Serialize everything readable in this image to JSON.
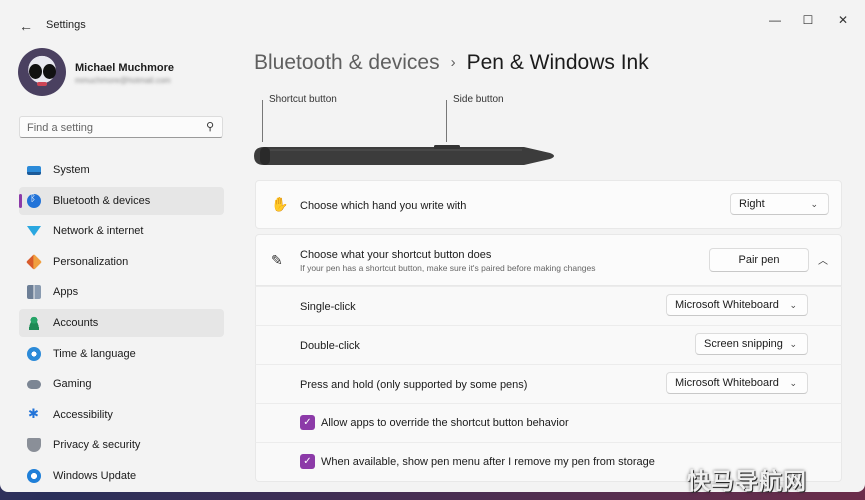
{
  "app": {
    "title": "Settings"
  },
  "window_controls": {
    "minimize": "—",
    "maximize": "☐",
    "close": "✕"
  },
  "user": {
    "name": "Michael Muchmore",
    "email": "mmuchmore@hotmail.com"
  },
  "search": {
    "placeholder": "Find a setting"
  },
  "sidebar": {
    "items": [
      {
        "label": "System",
        "icon": "system-icon"
      },
      {
        "label": "Bluetooth & devices",
        "icon": "bluetooth-icon",
        "active": true
      },
      {
        "label": "Network & internet",
        "icon": "network-icon"
      },
      {
        "label": "Personalization",
        "icon": "personalization-icon"
      },
      {
        "label": "Apps",
        "icon": "apps-icon"
      },
      {
        "label": "Accounts",
        "icon": "accounts-icon"
      },
      {
        "label": "Time & language",
        "icon": "time-language-icon"
      },
      {
        "label": "Gaming",
        "icon": "gaming-icon"
      },
      {
        "label": "Accessibility",
        "icon": "accessibility-icon"
      },
      {
        "label": "Privacy & security",
        "icon": "privacy-icon"
      },
      {
        "label": "Windows Update",
        "icon": "windows-update-icon"
      }
    ]
  },
  "breadcrumb": {
    "parent": "Bluetooth & devices",
    "separator": "›",
    "current": "Pen & Windows Ink"
  },
  "pen_diagram": {
    "shortcut_label": "Shortcut button",
    "side_label": "Side button"
  },
  "settings": {
    "hand": {
      "title": "Choose which hand you write with",
      "value": "Right"
    },
    "shortcut": {
      "title": "Choose what your shortcut button does",
      "description": "If your pen has a shortcut button, make sure it's paired before making changes",
      "pair_button": "Pair pen",
      "single_click": {
        "label": "Single-click",
        "value": "Microsoft Whiteboard"
      },
      "double_click": {
        "label": "Double-click",
        "value": "Screen snipping"
      },
      "press_hold": {
        "label": "Press and hold (only supported by some pens)",
        "value": "Microsoft Whiteboard"
      },
      "allow_override": {
        "label": "Allow apps to override the shortcut button behavior",
        "checked": true
      },
      "pen_menu": {
        "label": "When available, show pen menu after I remove my pen from storage",
        "checked": true
      }
    }
  },
  "watermark": "快马导航网",
  "colors": {
    "accent": "#8c3aa8",
    "background": "#f3f3f3",
    "card": "#fbfbfb"
  }
}
